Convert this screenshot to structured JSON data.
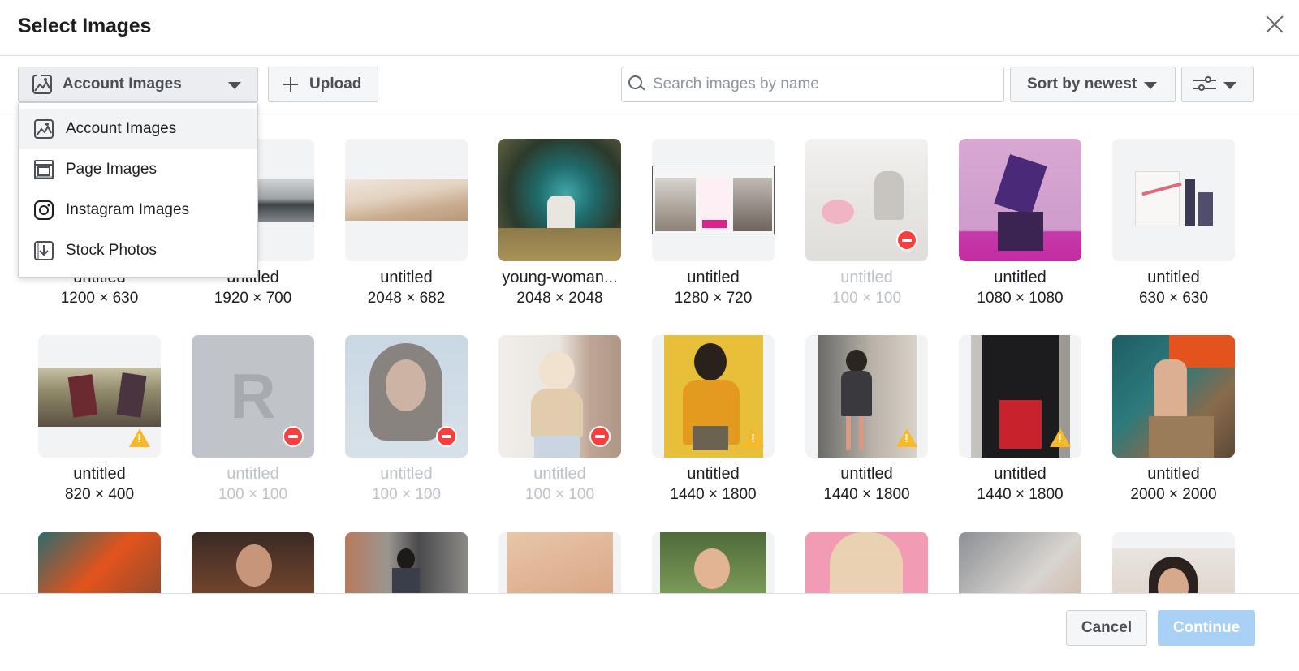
{
  "dialog": {
    "title": "Select Images"
  },
  "toolbar": {
    "source_label": "Account Images",
    "upload_label": "Upload",
    "search_placeholder": "Search images by name",
    "sort_label": "Sort by newest"
  },
  "source_menu": {
    "items": [
      {
        "label": "Account Images",
        "icon": "image-icon"
      },
      {
        "label": "Page Images",
        "icon": "page-icon"
      },
      {
        "label": "Instagram Images",
        "icon": "instagram-icon"
      },
      {
        "label": "Stock Photos",
        "icon": "stock-photo-icon"
      }
    ]
  },
  "images": [
    {
      "name": "untitled",
      "dimensions": "1200 × 630",
      "status": "ok"
    },
    {
      "name": "untitled",
      "dimensions": "1920 × 700",
      "status": "ok"
    },
    {
      "name": "untitled",
      "dimensions": "2048 × 682",
      "status": "ok"
    },
    {
      "name": "young-woman...",
      "dimensions": "2048 × 2048",
      "status": "ok"
    },
    {
      "name": "untitled",
      "dimensions": "1280 × 720",
      "status": "ok"
    },
    {
      "name": "untitled",
      "dimensions": "100 × 100",
      "status": "blocked"
    },
    {
      "name": "untitled",
      "dimensions": "1080 × 1080",
      "status": "ok"
    },
    {
      "name": "untitled",
      "dimensions": "630 × 630",
      "status": "ok"
    },
    {
      "name": "untitled",
      "dimensions": "820 × 400",
      "status": "warning"
    },
    {
      "name": "untitled",
      "dimensions": "100 × 100",
      "status": "blocked",
      "placeholder_letter": "R"
    },
    {
      "name": "untitled",
      "dimensions": "100 × 100",
      "status": "blocked"
    },
    {
      "name": "untitled",
      "dimensions": "100 × 100",
      "status": "blocked"
    },
    {
      "name": "untitled",
      "dimensions": "1440 × 1800",
      "status": "warning"
    },
    {
      "name": "untitled",
      "dimensions": "1440 × 1800",
      "status": "warning"
    },
    {
      "name": "untitled",
      "dimensions": "1440 × 1800",
      "status": "warning"
    },
    {
      "name": "untitled",
      "dimensions": "2000 × 2000",
      "status": "ok"
    }
  ],
  "footer": {
    "cancel_label": "Cancel",
    "continue_label": "Continue"
  },
  "colors": {
    "primary_disabled": "#a8d1f5",
    "block_badge": "#fa3e3e",
    "warning_badge": "#f7b928",
    "border": "#ccd0d5"
  }
}
